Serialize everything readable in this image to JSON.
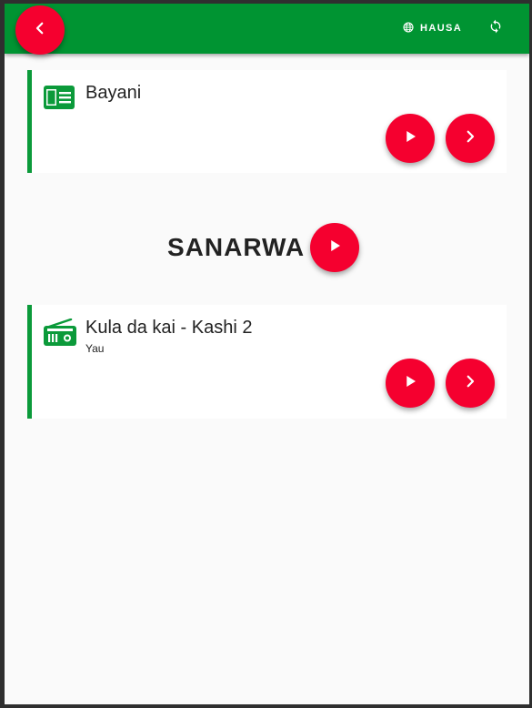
{
  "header": {
    "language_label": "HAUSA"
  },
  "cards": [
    {
      "title": "Bayani",
      "subtitle": "",
      "icon": "article-icon"
    },
    {
      "title": "Kula da kai - Kashi 2",
      "subtitle": "Yau",
      "icon": "radio-icon"
    }
  ],
  "section": {
    "title": "SANARWA"
  },
  "colors": {
    "appbar": "#009432",
    "accent": "#f5002f",
    "card_border": "#0b9a3a",
    "background": "#fafafa"
  }
}
